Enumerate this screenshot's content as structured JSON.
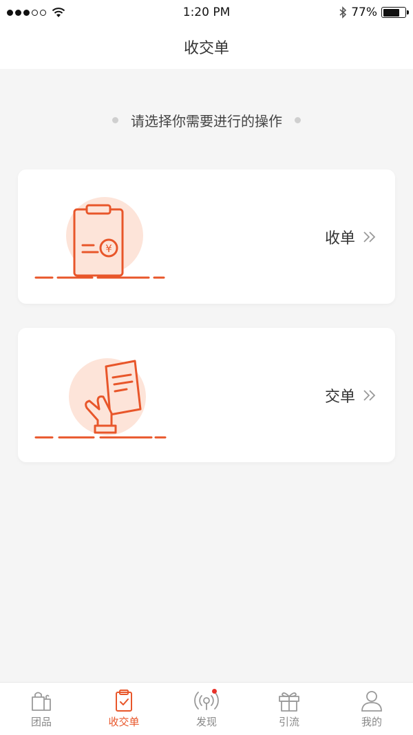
{
  "status_bar": {
    "time": "1:20 PM",
    "battery_text": "77%",
    "battery_level": 0.77,
    "icons": [
      "signal-dots-icon",
      "wifi-icon",
      "bluetooth-icon",
      "battery-icon"
    ]
  },
  "header": {
    "title": "收交单"
  },
  "prompt": {
    "text": "请选择你需要进行的操作"
  },
  "cards": [
    {
      "label": "收单",
      "icon": "receipt-clipboard-icon"
    },
    {
      "label": "交单",
      "icon": "hand-document-icon"
    }
  ],
  "tab_bar": {
    "items": [
      {
        "label": "团品",
        "icon": "shopping-bag-icon",
        "active": false
      },
      {
        "label": "收交单",
        "icon": "clipboard-check-icon",
        "active": true
      },
      {
        "label": "发现",
        "icon": "broadcast-icon",
        "active": false,
        "badge": true
      },
      {
        "label": "引流",
        "icon": "gift-icon",
        "active": false
      },
      {
        "label": "我的",
        "icon": "user-icon",
        "active": false
      }
    ]
  },
  "colors": {
    "accent": "#e8562a",
    "illustration_bg": "#fde4d9",
    "background": "#f5f5f5",
    "badge": "#e8322a"
  }
}
